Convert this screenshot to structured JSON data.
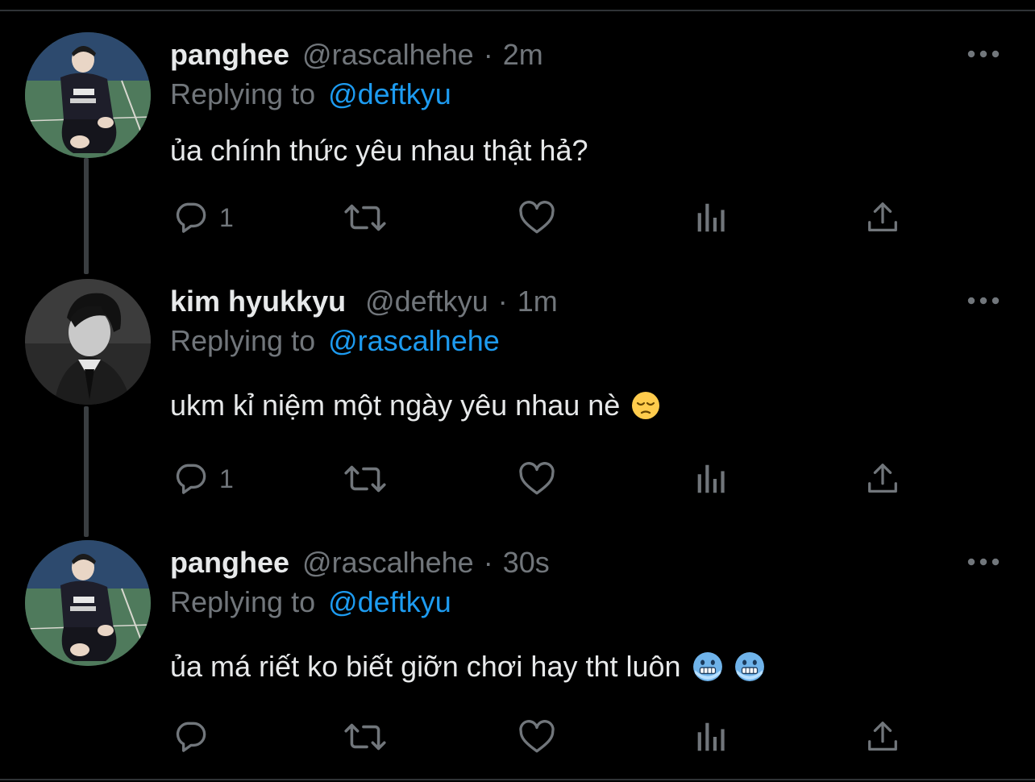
{
  "tweets": [
    {
      "display_name": "panghee",
      "handle": "@rascalhehe",
      "separator": "·",
      "time": "2m",
      "replying_label": "Replying to",
      "replying_to": "@deftkyu",
      "text": "ủa chính thức yêu nhau thật hả?",
      "emojis": [],
      "reply_count": "1",
      "avatar_icon": "avatar-photo-panghee"
    },
    {
      "display_name": "kim hyukkyu",
      "handle": "@deftkyu",
      "separator": "·",
      "time": "1m",
      "replying_label": "Replying to",
      "replying_to": "@rascalhehe",
      "text": "ukm kỉ niệm một ngày yêu nhau nè",
      "emojis": [
        "pensive-face-emoji"
      ],
      "reply_count": "1",
      "avatar_icon": "avatar-photo-kim-hyukkyu"
    },
    {
      "display_name": "panghee",
      "handle": "@rascalhehe",
      "separator": "·",
      "time": "30s",
      "replying_label": "Replying to",
      "replying_to": "@deftkyu",
      "text": "ủa má riết ko biết giỡn chơi hay tht luôn",
      "emojis": [
        "cold-face-emoji",
        "cold-face-emoji"
      ],
      "reply_count": "",
      "avatar_icon": "avatar-photo-panghee"
    }
  ],
  "icons": {
    "reply": "reply-icon",
    "retweet": "retweet-icon",
    "like": "like-icon",
    "views": "views-icon",
    "share": "share-icon",
    "more": "more-icon"
  },
  "colors": {
    "background": "#000000",
    "primary_text": "#e7e9ea",
    "secondary_text": "#71767b",
    "link": "#1d9bf0",
    "thread_line": "#3a3e41"
  }
}
